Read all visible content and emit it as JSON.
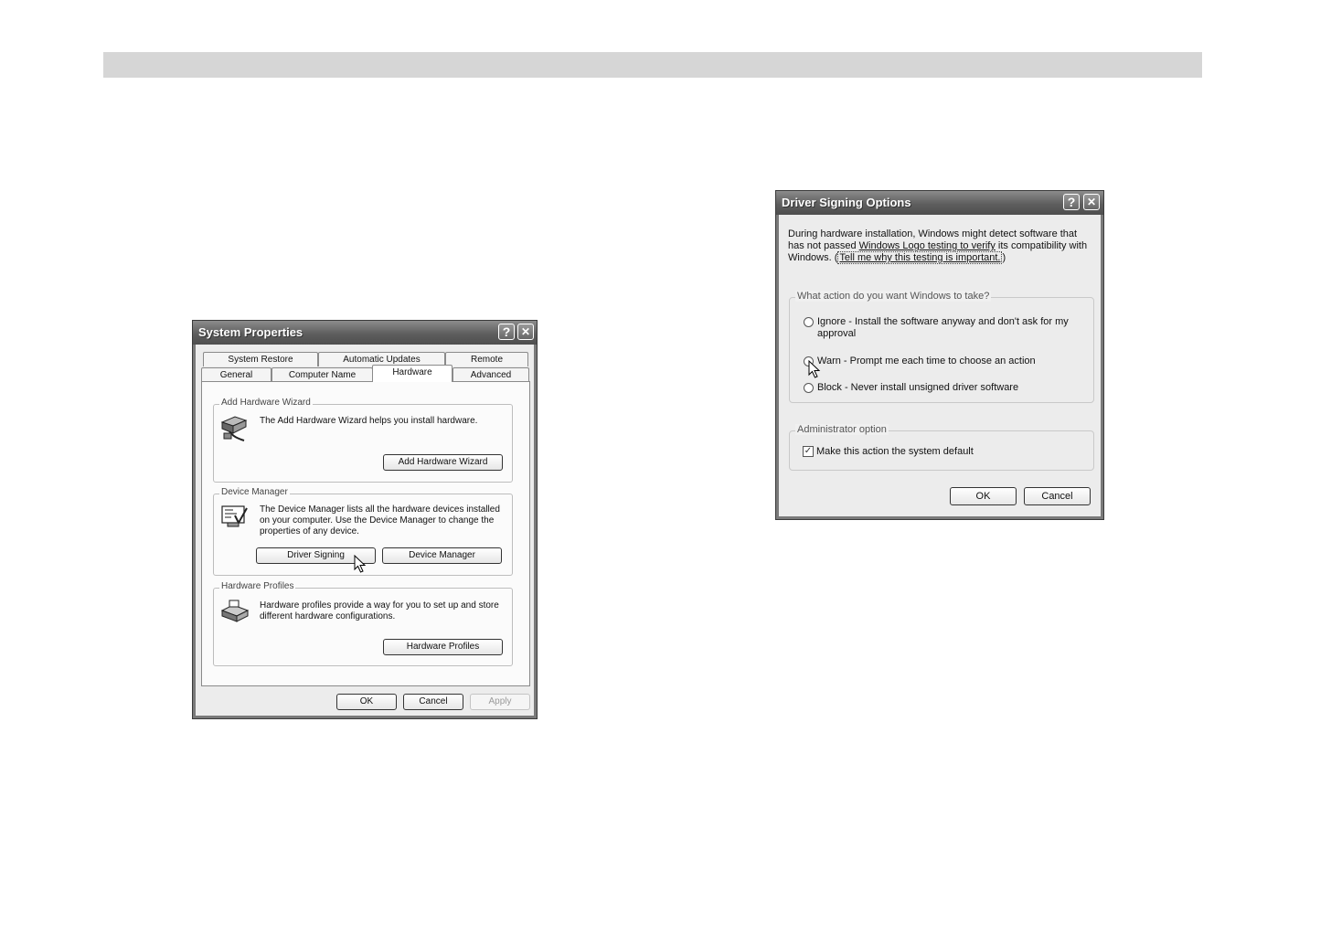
{
  "system_properties": {
    "title": "System Properties",
    "help_glyph": "?",
    "close_glyph": "✕",
    "tabs_row1": [
      "System Restore",
      "Automatic Updates",
      "Remote"
    ],
    "tabs_row2": [
      "General",
      "Computer Name",
      "Hardware",
      "Advanced"
    ],
    "active_tab": "Hardware",
    "add_hardware": {
      "group_label": "Add Hardware Wizard",
      "description": "The Add Hardware Wizard helps you install hardware.",
      "button": "Add Hardware Wizard"
    },
    "device_manager": {
      "group_label": "Device Manager",
      "description": "The Device Manager lists all the hardware devices installed on your computer. Use the Device Manager to change the properties of any device.",
      "button_driver_signing": "Driver Signing",
      "button_device_manager": "Device Manager"
    },
    "hardware_profiles": {
      "group_label": "Hardware Profiles",
      "description": "Hardware profiles provide a way for you to set up and store different hardware configurations.",
      "button": "Hardware Profiles"
    },
    "footer": {
      "ok": "OK",
      "cancel": "Cancel",
      "apply": "Apply"
    }
  },
  "driver_signing": {
    "title": "Driver Signing Options",
    "help_glyph": "?",
    "close_glyph": "✕",
    "intro_part1": "During hardware installation, Windows might detect software that has not passed ",
    "intro_link1": "Windows Logo testing to verify",
    "intro_part2": " its compatibility with Windows. (",
    "intro_link2": "Tell me why this testing is important.",
    "intro_part3": ")",
    "action_group_label": "What action do you want Windows to take?",
    "options": [
      "Ignore - Install the software anyway and don't ask for my approval",
      "Warn - Prompt me each time to choose an action",
      "Block - Never install unsigned driver software"
    ],
    "admin_group_label": "Administrator option",
    "checkbox_label": "Make this action the system default",
    "checkbox_checked": true,
    "check_glyph": "✓",
    "ok": "OK",
    "cancel": "Cancel"
  },
  "colors": {
    "topbar": "#d6d6d6",
    "titlebar": "#5e5e5e"
  }
}
